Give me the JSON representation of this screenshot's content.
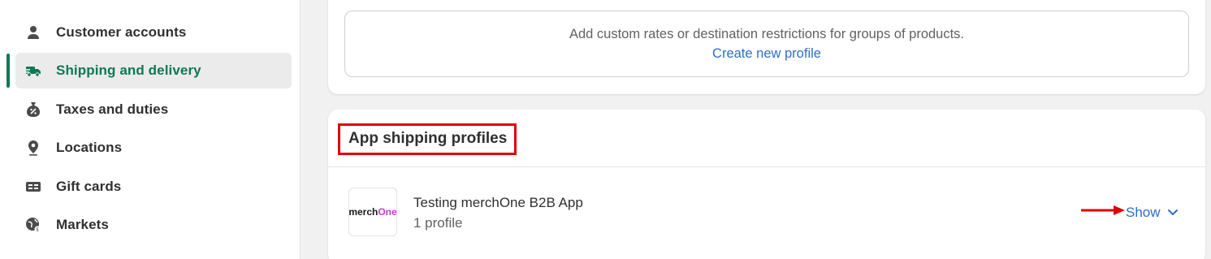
{
  "sidebar": {
    "items": [
      {
        "label": "Customer accounts",
        "icon": "person-icon"
      },
      {
        "label": "Shipping and delivery",
        "icon": "truck-icon",
        "active": true
      },
      {
        "label": "Taxes and duties",
        "icon": "tax-bag-icon"
      },
      {
        "label": "Locations",
        "icon": "location-pin-icon"
      },
      {
        "label": "Gift cards",
        "icon": "gift-card-icon"
      },
      {
        "label": "Markets",
        "icon": "globe-icon"
      }
    ]
  },
  "custom_profiles": {
    "hint": "Add custom rates or destination restrictions for groups of products.",
    "link": "Create new profile"
  },
  "app_profiles": {
    "title": "App shipping profiles",
    "app": {
      "logo_text_main": "merch",
      "logo_text_accent": "One",
      "name": "Testing merchOne B2B App",
      "profiles": "1 profile"
    },
    "show_label": "Show"
  },
  "colors": {
    "accent_green": "#0b7a53",
    "link_blue": "#2c6ecb",
    "annotation_red": "#e00000"
  }
}
